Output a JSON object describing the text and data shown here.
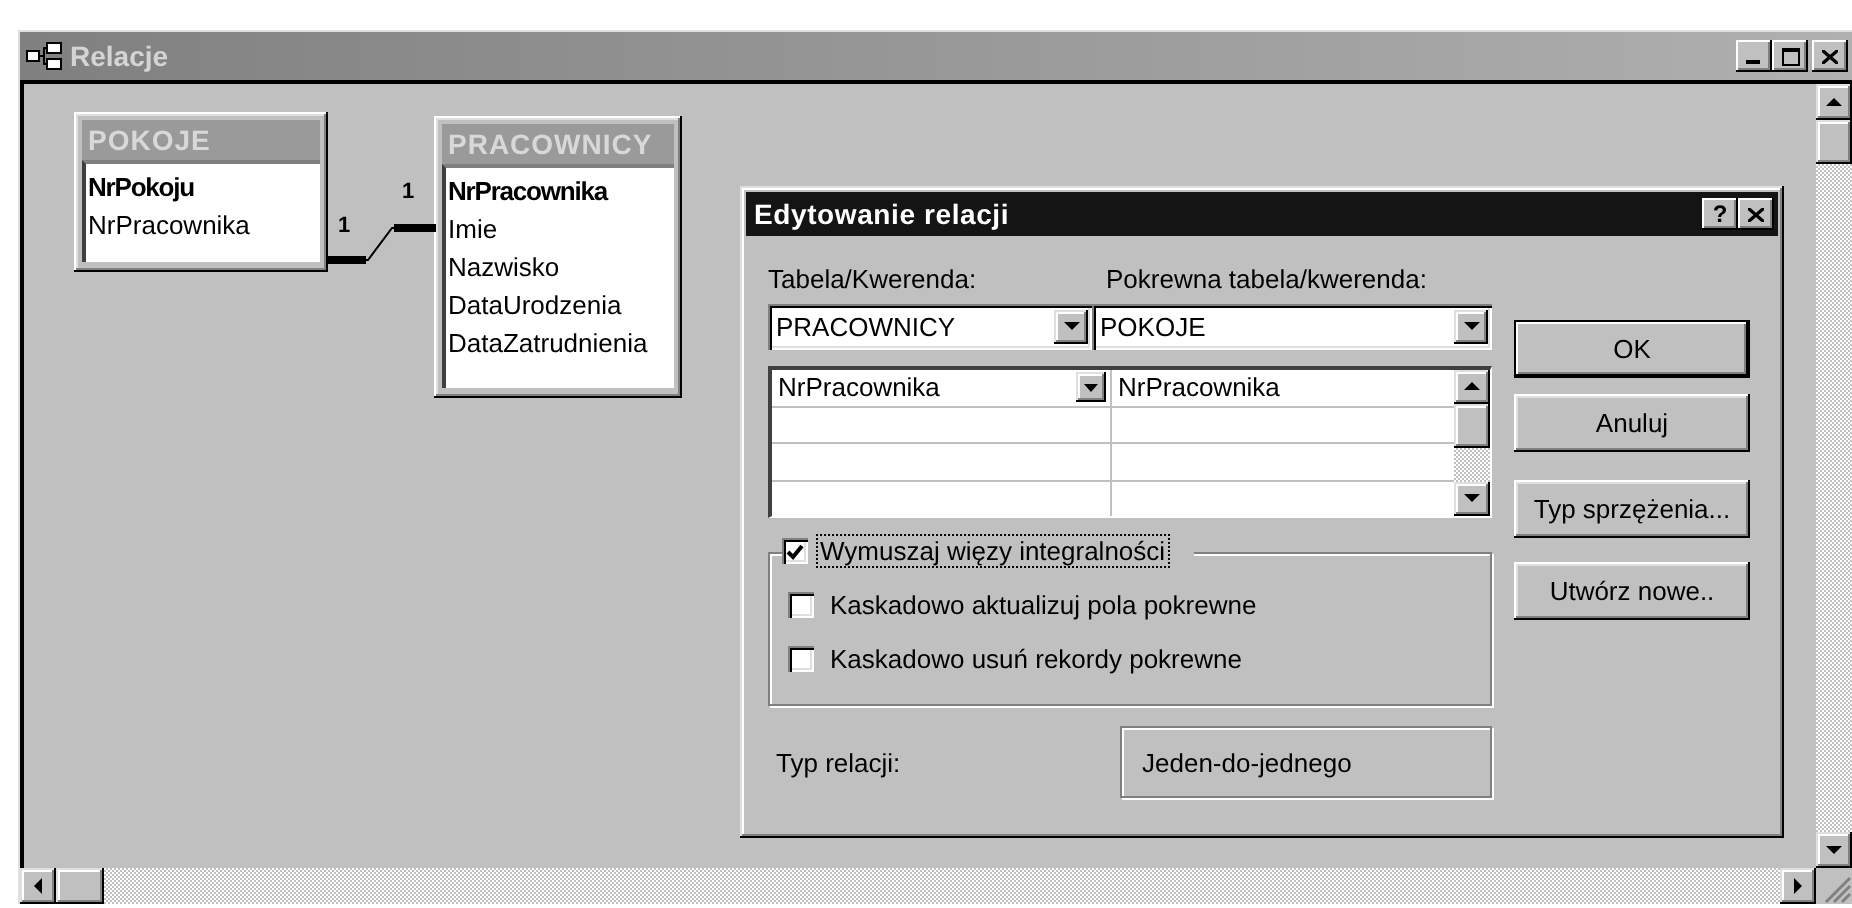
{
  "window": {
    "title": "Relacje"
  },
  "tables": [
    {
      "name": "POKOJE",
      "fields": [
        {
          "name": "NrPokoju",
          "key": true
        },
        {
          "name": "NrPracownika",
          "key": false
        }
      ]
    },
    {
      "name": "PRACOWNICY",
      "fields": [
        {
          "name": "NrPracownika",
          "key": true
        },
        {
          "name": "Imie",
          "key": false
        },
        {
          "name": "Nazwisko",
          "key": false
        },
        {
          "name": "DataUrodzenia",
          "key": false
        },
        {
          "name": "DataZatrudnienia",
          "key": false
        }
      ]
    }
  ],
  "relationship": {
    "from_label": "1",
    "to_label": "1"
  },
  "dialog": {
    "title": "Edytowanie relacji",
    "help": "?",
    "table": {
      "label": "Tabela/Kwerenda:",
      "value": "PRACOWNICY"
    },
    "related_table": {
      "label": "Pokrewna tabela/kwerenda:",
      "value": "POKOJE"
    },
    "field_rows": [
      {
        "field": "NrPracownika",
        "related_field": "NrPracownika"
      }
    ],
    "options": [
      {
        "kind": "legend",
        "label": "Wymuszaj więzy integralności",
        "checked": true,
        "focused": true
      },
      {
        "kind": "option",
        "label": "Kaskadowo aktualizuj pola pokrewne",
        "checked": false,
        "focused": false
      },
      {
        "kind": "option",
        "label": "Kaskadowo usuń rekordy pokrewne",
        "checked": false,
        "focused": false
      }
    ],
    "relation_type": {
      "label": "Typ relacji:",
      "value": "Jeden-do-jednego"
    },
    "buttons": [
      {
        "label": "OK",
        "default": true
      },
      {
        "label": "Anuluj",
        "default": false
      },
      {
        "label": "Typ sprzężenia...",
        "default": false
      },
      {
        "label": "Utwórz nowe..",
        "default": false
      }
    ]
  }
}
